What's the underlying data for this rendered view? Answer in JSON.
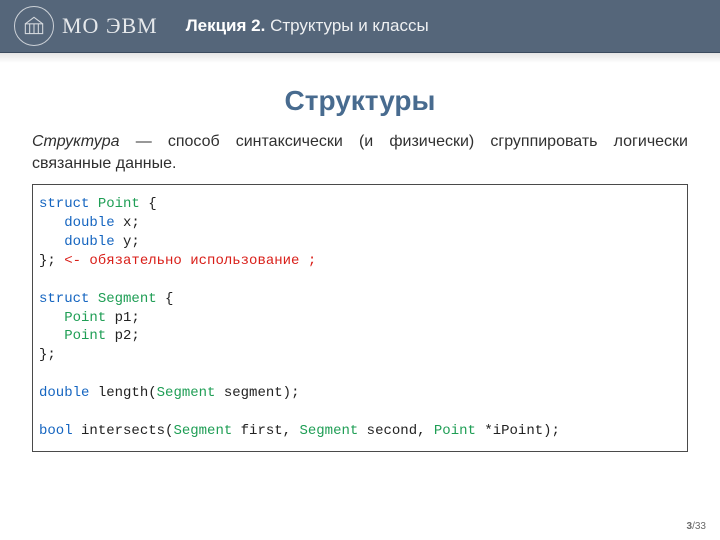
{
  "header": {
    "org": "МО ЭВМ",
    "lecture_prefix": "Лекция 2.",
    "lecture_topic": "Структуры и классы"
  },
  "title": "Структуры",
  "definition": {
    "term": "Структура",
    "rest": " — способ синтаксически (и физически) сгруппировать логически связанные данные."
  },
  "code": {
    "l1_kw": "struct",
    "l1_ty": " Point",
    "l1_rest": " {",
    "l2_kw": "   double",
    "l2_rest": " x;",
    "l3_kw": "   double",
    "l3_rest": " y;",
    "l4_rest": "}; ",
    "l4_cm": "<- обязательно использование ;",
    "blank": "",
    "l5_kw": "struct",
    "l5_ty": " Segment",
    "l5_rest": " {",
    "l6_ty": "   Point",
    "l6_rest": " p1;",
    "l7_ty": "   Point",
    "l7_rest": " p2;",
    "l8_rest": "};",
    "l9_kw": "double",
    "l9_id1": " length(",
    "l9_ty": "Segment",
    "l9_id2": " segment);",
    "l10_kw": "bool",
    "l10_id1": " intersects(",
    "l10_ty1": "Segment",
    "l10_id2": " first, ",
    "l10_ty2": "Segment",
    "l10_id3": " second, ",
    "l10_ty3": "Point",
    "l10_id4": " *iPoint);"
  },
  "page": {
    "current": "3",
    "sep": "/",
    "total": "33"
  }
}
